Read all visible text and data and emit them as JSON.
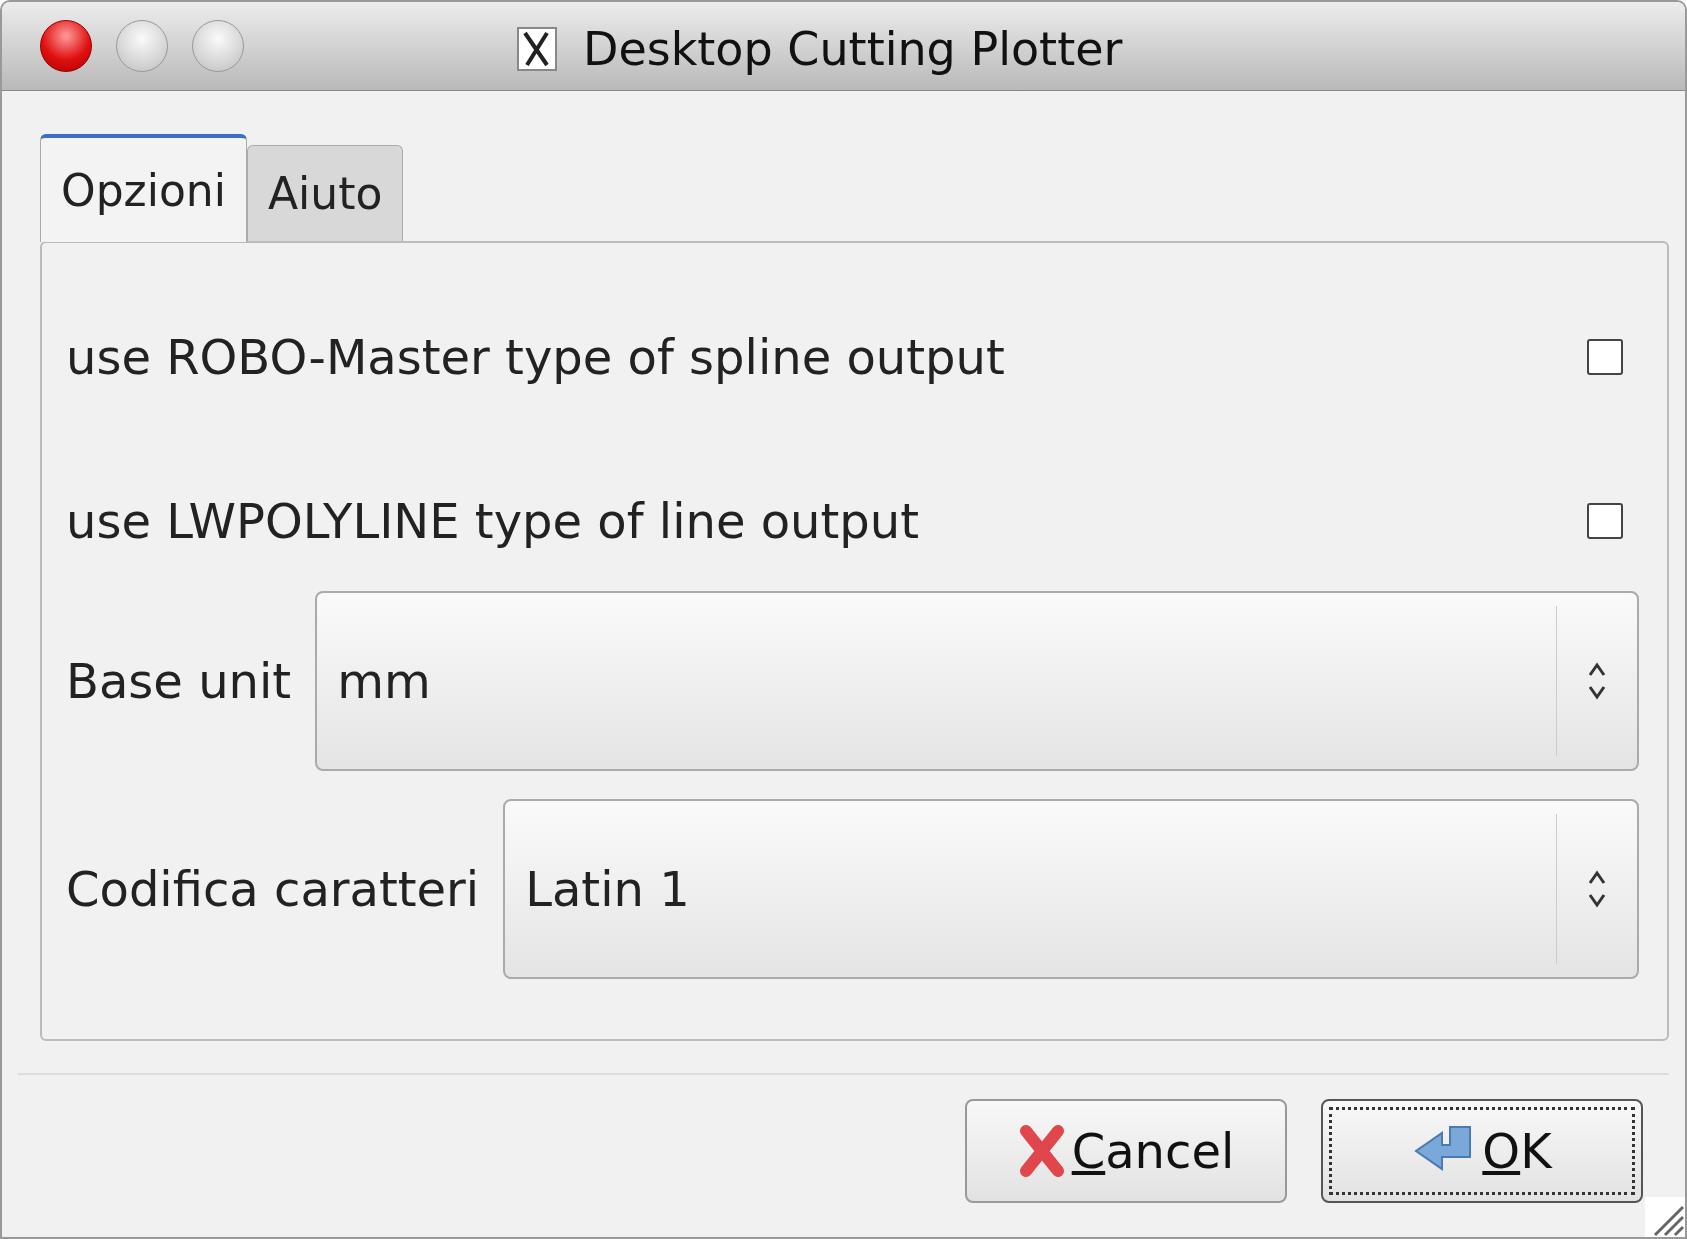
{
  "window": {
    "title": "Desktop Cutting Plotter"
  },
  "tabs": [
    {
      "label": "Opzioni",
      "selected": true
    },
    {
      "label": "Aiuto",
      "selected": false
    }
  ],
  "options": [
    {
      "kind": "checkbox",
      "label": "use ROBO-Master type of spline output",
      "checked": false
    },
    {
      "kind": "checkbox",
      "label": "use LWPOLYLINE type of line output",
      "checked": false
    },
    {
      "kind": "combo",
      "label": "Base unit",
      "value": "mm"
    },
    {
      "kind": "combo",
      "label": "Codifica caratteri",
      "value": "Latin 1"
    }
  ],
  "buttons": [
    {
      "kind": "cancel",
      "label": "Cancel",
      "mnemonic": true,
      "focused": false
    },
    {
      "kind": "ok",
      "label": "OK",
      "mnemonic": true,
      "focused": true
    }
  ]
}
